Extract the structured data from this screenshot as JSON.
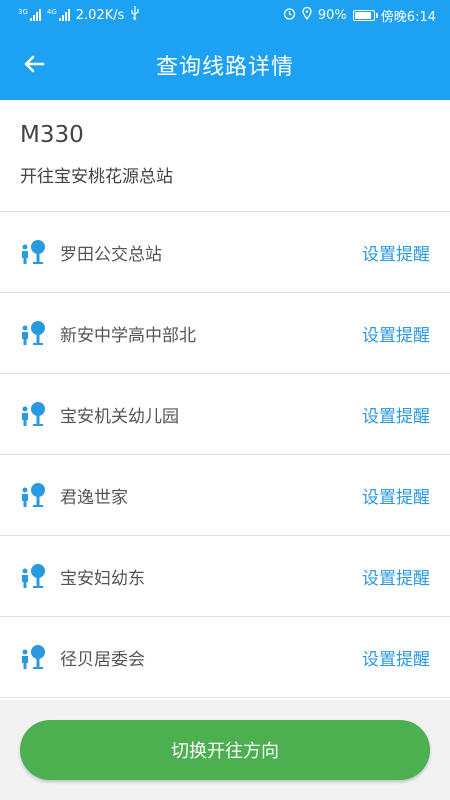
{
  "status_bar": {
    "signal_1_label": "3G",
    "signal_2_label": "4G",
    "net_speed": "2.02K/s",
    "battery": "90%",
    "time": "傍晚6:14"
  },
  "header": {
    "title": "查询线路详情",
    "icon_back": "arrow-left",
    "color": "#1da1f2"
  },
  "route": {
    "number": "M330",
    "direction": "开往宝安桃花源总站"
  },
  "stops": [
    {
      "name": "罗田公交总站",
      "action": "设置提醒"
    },
    {
      "name": "新安中学高中部北",
      "action": "设置提醒"
    },
    {
      "name": "宝安机关幼儿园",
      "action": "设置提醒"
    },
    {
      "name": "君逸世家",
      "action": "设置提醒"
    },
    {
      "name": "宝安妇幼东",
      "action": "设置提醒"
    },
    {
      "name": "径贝居委会",
      "action": "设置提醒"
    }
  ],
  "footer": {
    "switch_label": "切换开往方向",
    "button_color": "#4caf50"
  }
}
